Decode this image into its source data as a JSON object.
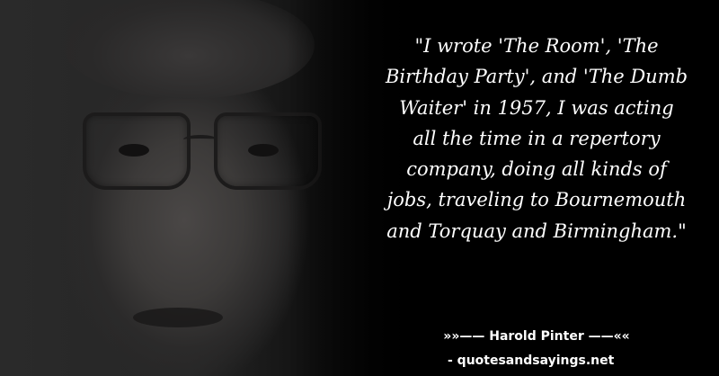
{
  "quote": {
    "lines": [
      "\"I wrote 'The Room', 'The",
      "Birthday Party', and 'The Dumb",
      "Waiter' in 1957, I was acting",
      "all the time in a repertory",
      "company, doing all kinds of",
      "jobs, traveling to Bournemouth",
      "and Torquay and Birmingham.\""
    ]
  },
  "attribution": "»»—— Harold Pinter ——««",
  "website": "- quotesandsayings.net"
}
